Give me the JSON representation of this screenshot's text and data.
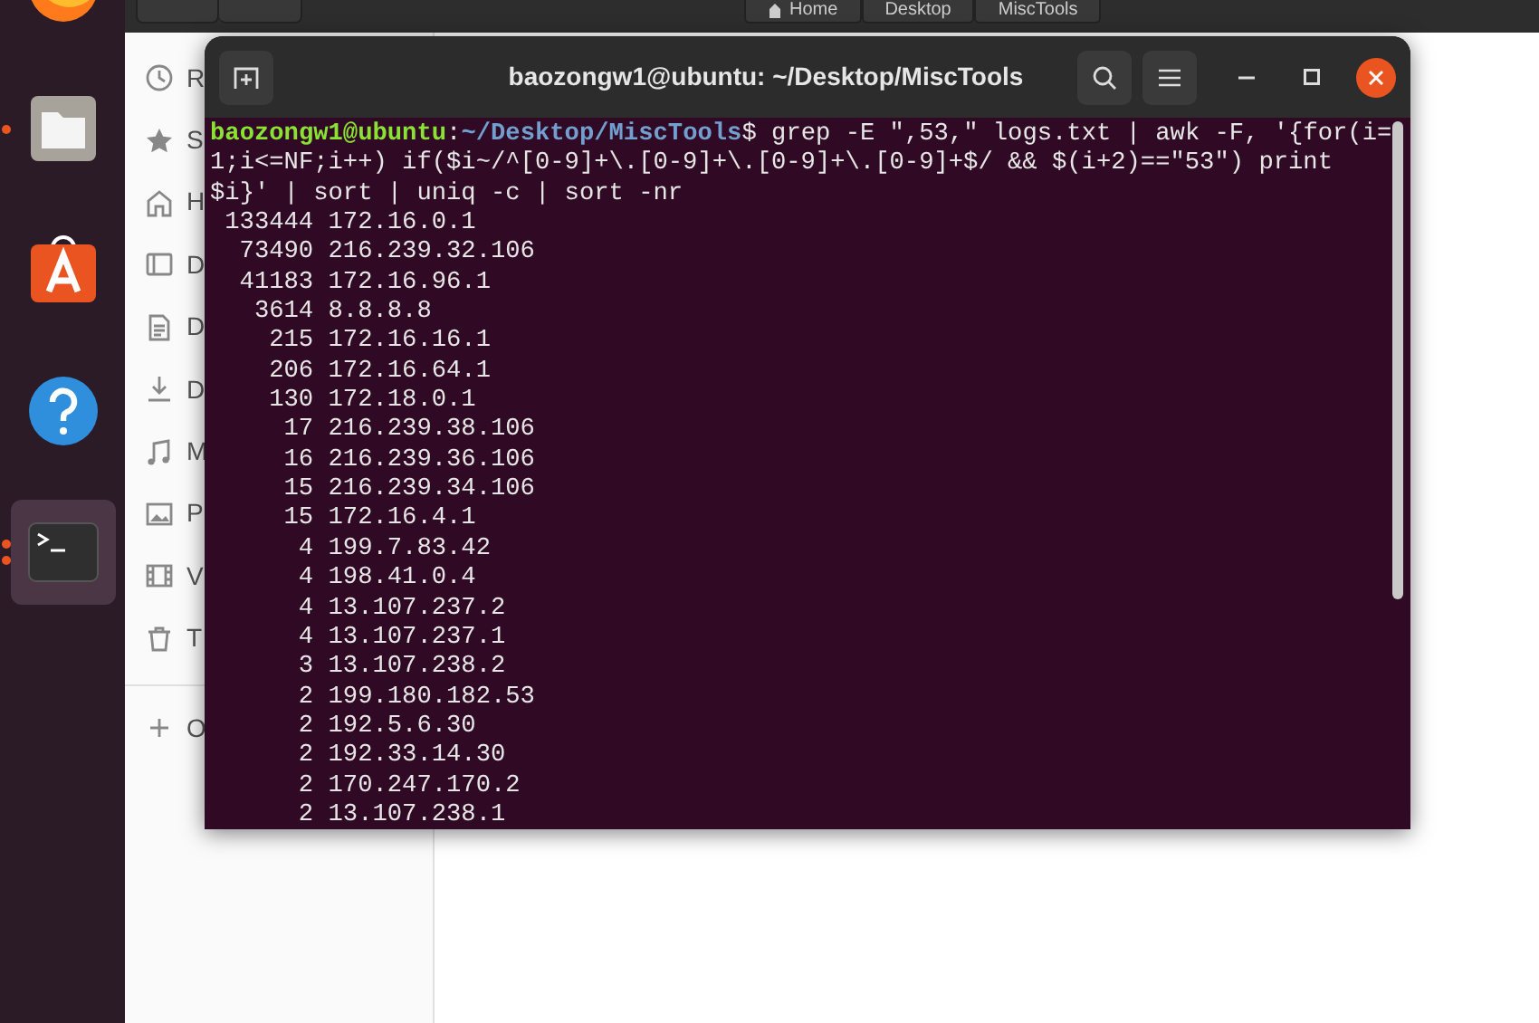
{
  "dock": {
    "items": [
      {
        "kind": "browser",
        "selected": false
      },
      {
        "kind": "files",
        "running": true,
        "multiple_windows": false,
        "selected": false
      },
      {
        "kind": "store",
        "running": false,
        "selected": false
      },
      {
        "kind": "help",
        "running": false,
        "selected": false
      },
      {
        "kind": "terminal",
        "running": true,
        "multiple_windows": true,
        "selected": true
      }
    ]
  },
  "file_manager": {
    "breadcrumbs": [
      {
        "label": "Home",
        "kind": "home"
      },
      {
        "label": "Desktop",
        "kind": "folder"
      },
      {
        "label": "MiscTools",
        "kind": "folder"
      }
    ],
    "sidebar": {
      "items": [
        {
          "label": "R",
          "kind": "recent"
        },
        {
          "label": "S",
          "kind": "starred"
        },
        {
          "label": "H",
          "kind": "home"
        },
        {
          "label": "D",
          "kind": "desktop"
        },
        {
          "label": "D",
          "kind": "documents"
        },
        {
          "label": "D",
          "kind": "downloads"
        },
        {
          "label": "M",
          "kind": "music"
        },
        {
          "label": "P",
          "kind": "pictures"
        },
        {
          "label": "V",
          "kind": "videos"
        },
        {
          "label": "T",
          "kind": "trash"
        },
        {
          "label": "O",
          "kind": "other"
        }
      ]
    }
  },
  "terminal": {
    "title": "baozongw1@ubuntu: ~/Desktop/MiscTools",
    "prompt": {
      "user_host": "baozongw1@ubuntu",
      "separator": ":",
      "path": "~/Desktop/MiscTools",
      "symbol": "$",
      "command": " grep -E \",53,\" logs.txt | awk -F, '{for(i=1;i<=NF;i++) if($i~/^[0-9]+\\.[0-9]+\\.[0-9]+\\.[0-9]+$/ && $(i+2)==\"53\") print $i}' | sort | uniq -c | sort -nr"
    },
    "rows": [
      {
        "count": "133444",
        "address": "172.16.0.1"
      },
      {
        "count": "73490",
        "address": "216.239.32.106"
      },
      {
        "count": "41183",
        "address": "172.16.96.1"
      },
      {
        "count": "3614",
        "address": "8.8.8.8"
      },
      {
        "count": "215",
        "address": "172.16.16.1"
      },
      {
        "count": "206",
        "address": "172.16.64.1"
      },
      {
        "count": "130",
        "address": "172.18.0.1"
      },
      {
        "count": "17",
        "address": "216.239.38.106"
      },
      {
        "count": "16",
        "address": "216.239.36.106"
      },
      {
        "count": "15",
        "address": "216.239.34.106"
      },
      {
        "count": "15",
        "address": "172.16.4.1"
      },
      {
        "count": "4",
        "address": "199.7.83.42"
      },
      {
        "count": "4",
        "address": "198.41.0.4"
      },
      {
        "count": "4",
        "address": "13.107.237.2"
      },
      {
        "count": "4",
        "address": "13.107.237.1"
      },
      {
        "count": "3",
        "address": "13.107.238.2"
      },
      {
        "count": "2",
        "address": "199.180.182.53"
      },
      {
        "count": "2",
        "address": "192.5.6.30"
      },
      {
        "count": "2",
        "address": "192.33.14.30"
      },
      {
        "count": "2",
        "address": "170.247.170.2"
      },
      {
        "count": "2",
        "address": "13.107.238.1"
      }
    ]
  }
}
